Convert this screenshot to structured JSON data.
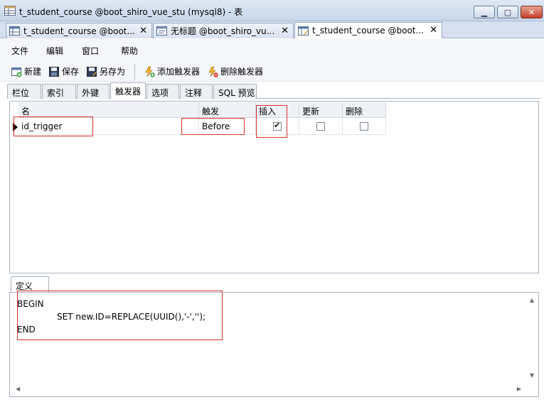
{
  "window": {
    "title": "t_student_course @boot_shiro_vue_stu (mysql8) - 表"
  },
  "doc_tabs": [
    {
      "label": "t_student_course @boot..."
    },
    {
      "label": "无标题 @boot_shiro_vu..."
    },
    {
      "label": "t_student_course @boot..."
    }
  ],
  "menu": {
    "file": "文件",
    "edit": "编辑",
    "window": "窗口",
    "help": "帮助"
  },
  "toolbar": {
    "new": "新建",
    "save": "保存",
    "save_as": "另存为",
    "add_trigger": "添加触发器",
    "delete_trigger": "删除触发器"
  },
  "sub_tabs": {
    "fields": "栏位",
    "indexes": "索引",
    "foreign_keys": "外键",
    "triggers": "触发器",
    "options": "选项",
    "comments": "注释",
    "sql_preview": "SQL 预览"
  },
  "grid": {
    "headers": {
      "name": "名",
      "fire": "触发",
      "insert": "插入",
      "update": "更新",
      "delete": "删除"
    },
    "rows": [
      {
        "name": "id_trigger",
        "fire": "Before",
        "insert": true,
        "update": false,
        "delete": false
      }
    ]
  },
  "definition": {
    "tab": "定义",
    "code": [
      "BEGIN",
      "\t\tSET new.ID=REPLACE(UUID(),'-','');",
      "END"
    ]
  },
  "colors": {
    "highlight_box": "#d9302a",
    "titlebar": "#c7d6ea"
  }
}
